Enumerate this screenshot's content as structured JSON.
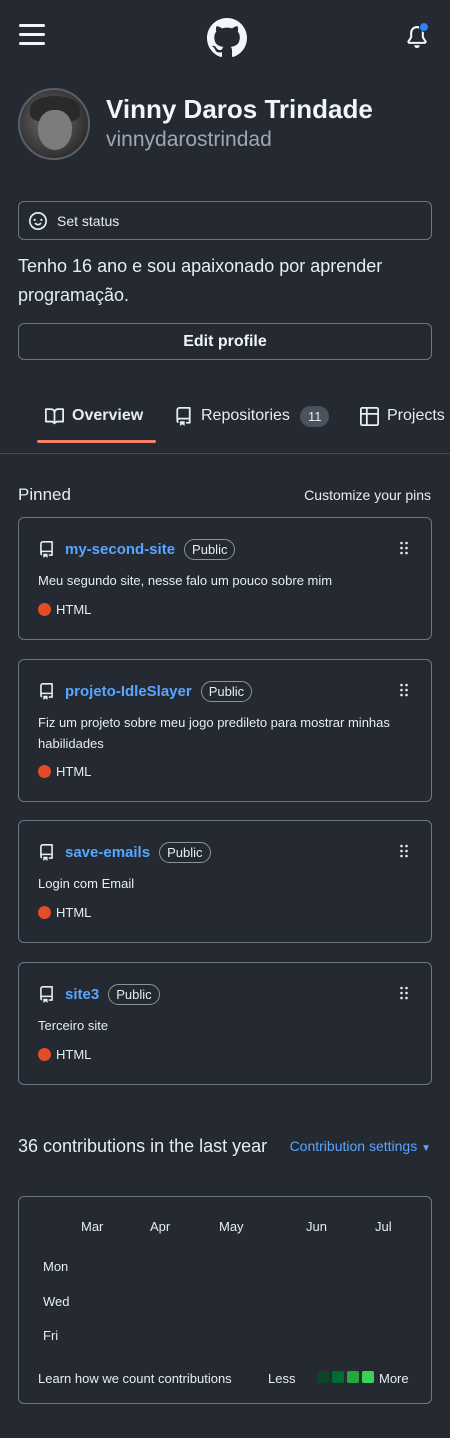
{
  "header": {
    "menu_icon": "hamburger-menu-icon",
    "logo_icon": "github-logo-icon",
    "notifications_icon": "bell-icon",
    "notification_dot_color": "#2f81f7"
  },
  "profile": {
    "display_name": "Vinny Daros Trindade",
    "username": "vinnydarostrindad",
    "set_status_label": "Set status",
    "bio": "Tenho 16 ano e sou apaixonado por aprender programação.",
    "edit_profile_label": "Edit profile"
  },
  "tabs": [
    {
      "label": "Overview",
      "icon": "book-icon",
      "selected": true
    },
    {
      "label": "Repositories",
      "icon": "repo-icon",
      "count": "11"
    },
    {
      "label": "Projects",
      "icon": "table-icon"
    }
  ],
  "pinned": {
    "title": "Pinned",
    "customize_label": "Customize your pins",
    "items": [
      {
        "name": "my-second-site",
        "visibility": "Public",
        "description": "Meu segundo site, nesse falo um pouco sobre mim",
        "language": "HTML",
        "language_color": "#e34c26"
      },
      {
        "name": "projeto-IdleSlayer",
        "visibility": "Public",
        "description": "Fiz um projeto sobre meu jogo predileto para mostrar minhas habilidades",
        "language": "HTML",
        "language_color": "#e34c26"
      },
      {
        "name": "save-emails",
        "visibility": "Public",
        "description": "Login com Email",
        "language": "HTML",
        "language_color": "#e34c26"
      },
      {
        "name": "site3",
        "visibility": "Public",
        "description": "Terceiro site",
        "language": "HTML",
        "language_color": "#e34c26"
      }
    ]
  },
  "contributions": {
    "title": "36 contributions in the last year",
    "settings_label": "Contribution settings",
    "months": [
      "Mar",
      "Apr",
      "May",
      "Jun",
      "Jul"
    ],
    "days": [
      "Mon",
      "Wed",
      "Fri"
    ],
    "learn_label": "Learn how we count contributions",
    "less_label": "Less",
    "more_label": "More",
    "legend_colors": [
      "#0e4429",
      "#006d32",
      "#26a641",
      "#39d353"
    ]
  },
  "colors": {
    "accent": "#f78166",
    "link": "#58a6ff",
    "background": "#242932"
  }
}
